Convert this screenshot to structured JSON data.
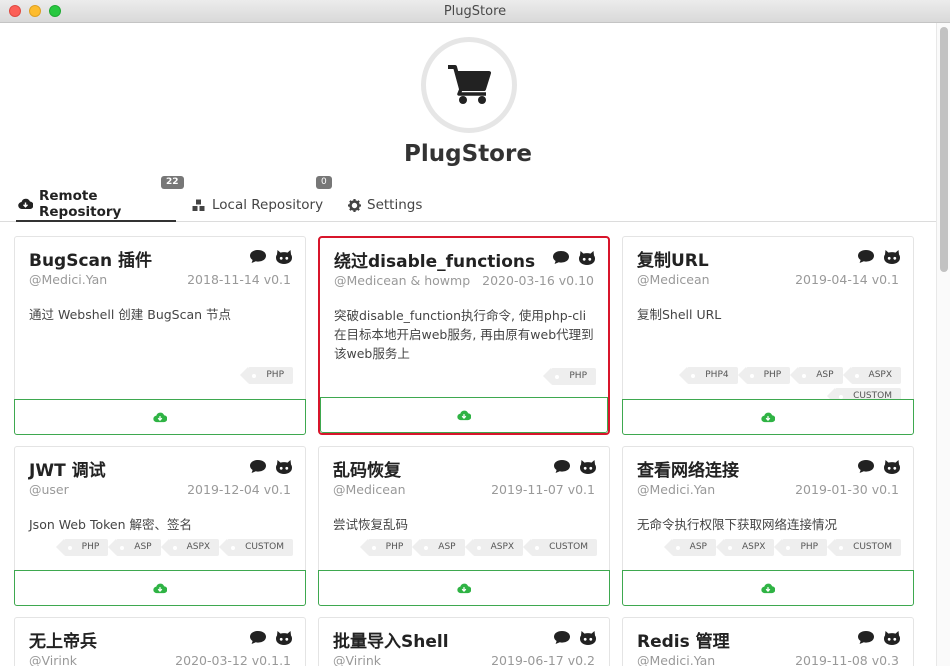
{
  "window": {
    "title": "PlugStore"
  },
  "header": {
    "app_name": "PlugStore"
  },
  "tabs": [
    {
      "label": "Remote Repository",
      "badge": "22"
    },
    {
      "label": "Local Repository",
      "badge": "0"
    },
    {
      "label": "Settings"
    }
  ],
  "colors": {
    "download": "#2fb344",
    "selected_border": "#d8152b",
    "badge": "#777777"
  },
  "plugins": [
    {
      "title": "BugScan 插件",
      "author": "@Medici.Yan",
      "meta": "2018-11-14 v0.1",
      "desc": "通过 Webshell 创建 BugScan 节点",
      "tags": [
        "PHP"
      ]
    },
    {
      "title": "绕过disable_functions",
      "author": "@Medicean & howmp",
      "meta": "2020-03-16 v0.10",
      "desc": "突破disable_function执行命令, 使用php-cli在目标本地开启web服务, 再由原有web代理到该web服务上",
      "tags": [
        "PHP"
      ]
    },
    {
      "title": "复制URL",
      "author": "@Medicean",
      "meta": "2019-04-14 v0.1",
      "desc": "复制Shell URL",
      "tags": [
        "PHP4",
        "PHP",
        "ASP",
        "ASPX",
        "CUSTOM"
      ]
    },
    {
      "title": "JWT 调试",
      "author": "@user",
      "meta": "2019-12-04 v0.1",
      "desc": "Json Web Token 解密、签名",
      "tags": [
        "PHP",
        "ASP",
        "ASPX",
        "CUSTOM"
      ]
    },
    {
      "title": "乱码恢复",
      "author": "@Medicean",
      "meta": "2019-11-07 v0.1",
      "desc": "尝试恢复乱码",
      "tags": [
        "PHP",
        "ASP",
        "ASPX",
        "CUSTOM"
      ]
    },
    {
      "title": "查看网络连接",
      "author": "@Medici.Yan",
      "meta": "2019-01-30 v0.1",
      "desc": "无命令执行权限下获取网络连接情况",
      "tags": [
        "ASP",
        "ASPX",
        "PHP",
        "CUSTOM"
      ]
    },
    {
      "title": "无上帝兵",
      "author": "@Virink",
      "meta": "2020-03-12 v0.1.1",
      "desc": "",
      "tags": []
    },
    {
      "title": "批量导入Shell",
      "author": "@Virink",
      "meta": "2019-06-17 v0.2",
      "desc": "",
      "tags": []
    },
    {
      "title": "Redis 管理",
      "author": "@Medici.Yan",
      "meta": "2019-11-08 v0.3",
      "desc": "",
      "tags": []
    }
  ]
}
